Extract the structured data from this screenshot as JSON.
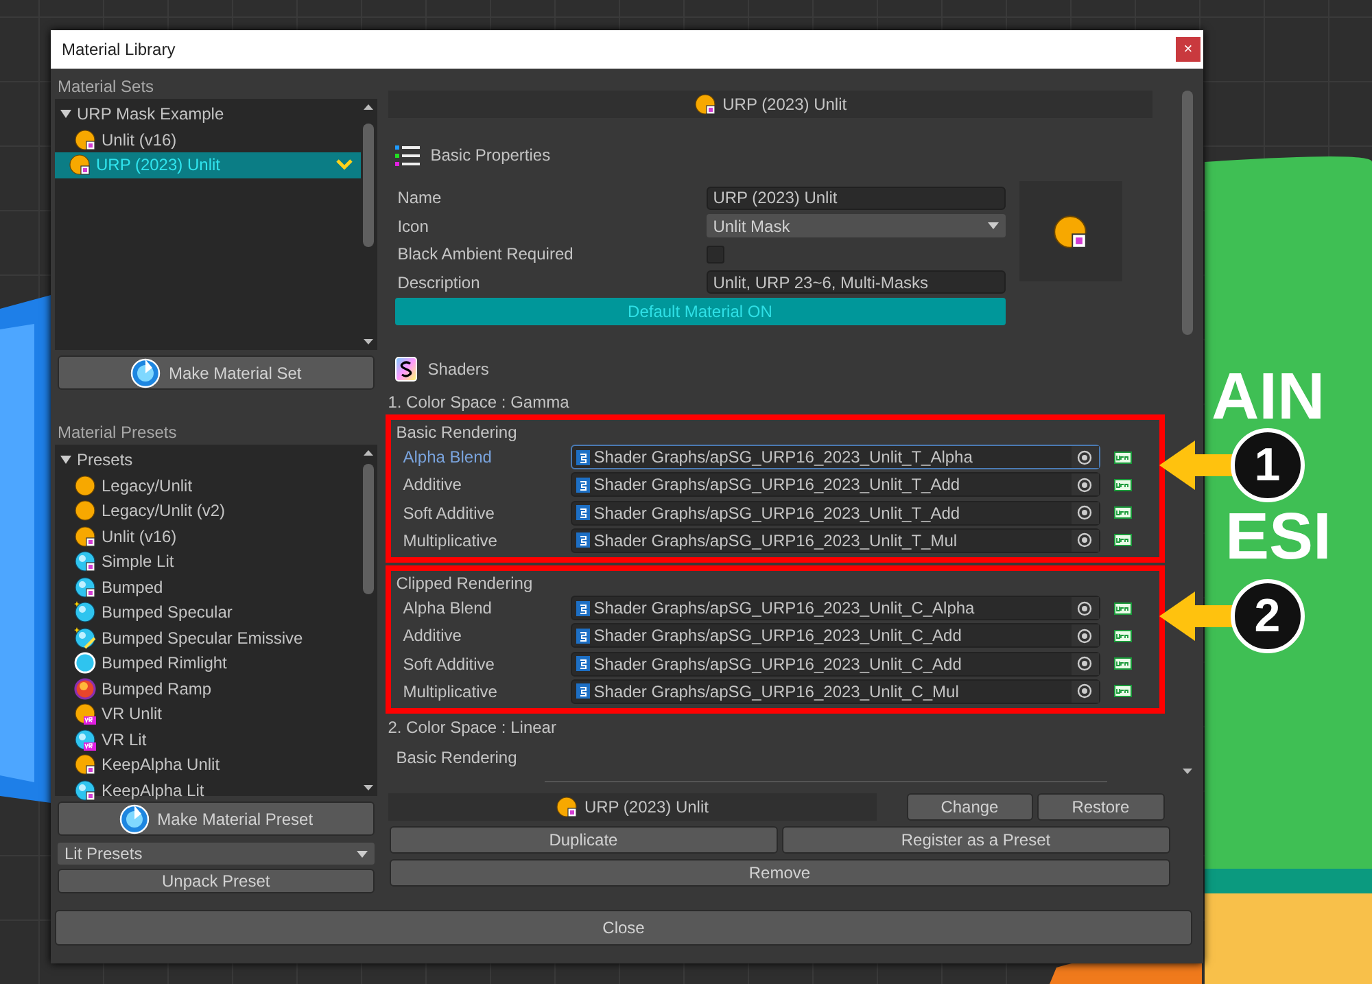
{
  "window": {
    "title": "Material Library",
    "close_label": "×"
  },
  "canvas": {
    "texts": [
      "AIN",
      "ESI"
    ]
  },
  "material_sets": {
    "title": "Material Sets",
    "tree": {
      "label": "URP Mask Example",
      "expanded": true,
      "children": [
        {
          "label": "Unlit (v16)",
          "kind": "unlit-mask",
          "selected": false
        },
        {
          "label": "URP (2023) Unlit",
          "kind": "unlit-mask",
          "selected": true
        }
      ]
    },
    "button": "Make Material Set"
  },
  "material_presets": {
    "title": "Material Presets",
    "tree": {
      "label": "Presets",
      "expanded": true,
      "children": [
        {
          "label": "Legacy/Unlit",
          "kind": "unlit",
          "selected": false
        },
        {
          "label": "Legacy/Unlit (v2)",
          "kind": "unlit",
          "selected": false
        },
        {
          "label": "Unlit (v16)",
          "kind": "unlit-mask",
          "selected": false
        },
        {
          "label": "Simple Lit",
          "kind": "lit-mask",
          "selected": false
        },
        {
          "label": "Bumped",
          "kind": "lit-mask",
          "selected": false
        },
        {
          "label": "Bumped Specular",
          "kind": "specular",
          "selected": false
        },
        {
          "label": "Bumped Specular Emissive",
          "kind": "emissive",
          "selected": false
        },
        {
          "label": "Bumped Rimlight",
          "kind": "rimlight",
          "selected": false
        },
        {
          "label": "Bumped Ramp",
          "kind": "ramp",
          "selected": false
        },
        {
          "label": "VR Unlit",
          "kind": "vr-unlit",
          "selected": false
        },
        {
          "label": "VR Lit",
          "kind": "vr-lit",
          "selected": false
        },
        {
          "label": "KeepAlpha Unlit",
          "kind": "unlit-mask",
          "selected": false
        },
        {
          "label": "KeepAlpha Lit",
          "kind": "lit-mask",
          "selected": false
        }
      ]
    },
    "button": "Make Material Preset",
    "dropdown": "Lit Presets",
    "unpack_button": "Unpack Preset"
  },
  "header": {
    "title": "URP (2023) Unlit",
    "kind": "unlit-mask"
  },
  "basic_properties": {
    "title": "Basic Properties",
    "fields": [
      {
        "label": "Name",
        "kind": "text",
        "value": "URP (2023) Unlit"
      },
      {
        "label": "Icon",
        "kind": "dropdown",
        "value": "Unlit Mask"
      },
      {
        "label": "Black Ambient Required",
        "kind": "checkbox",
        "checked": false
      },
      {
        "label": "Description",
        "kind": "text",
        "value": "Unlit, URP 23~6, Multi-Masks"
      }
    ],
    "default_button": {
      "label": "Default Material ON",
      "on": true
    }
  },
  "shaders": {
    "title": "Shaders",
    "color_spaces": [
      {
        "title": "1. Color Space : Gamma",
        "groups": [
          {
            "title": "Basic Rendering",
            "highlighted": true,
            "callout": "1",
            "rows": [
              {
                "label": "Alpha Blend",
                "value": "Shader Graphs/apSG_URP16_2023_Unlit_T_Alpha",
                "selected": true
              },
              {
                "label": "Additive",
                "value": "Shader Graphs/apSG_URP16_2023_Unlit_T_Add",
                "selected": false
              },
              {
                "label": "Soft Additive",
                "value": "Shader Graphs/apSG_URP16_2023_Unlit_T_Add",
                "selected": false
              },
              {
                "label": "Multiplicative",
                "value": "Shader Graphs/apSG_URP16_2023_Unlit_T_Mul",
                "selected": false
              }
            ]
          },
          {
            "title": "Clipped Rendering",
            "highlighted": true,
            "callout": "2",
            "rows": [
              {
                "label": "Alpha Blend",
                "value": "Shader Graphs/apSG_URP16_2023_Unlit_C_Alpha",
                "selected": false
              },
              {
                "label": "Additive",
                "value": "Shader Graphs/apSG_URP16_2023_Unlit_C_Add",
                "selected": false
              },
              {
                "label": "Soft Additive",
                "value": "Shader Graphs/apSG_URP16_2023_Unlit_C_Add",
                "selected": false
              },
              {
                "label": "Multiplicative",
                "value": "Shader Graphs/apSG_URP16_2023_Unlit_C_Mul",
                "selected": false
              }
            ]
          }
        ]
      },
      {
        "title": "2. Color Space : Linear",
        "groups": [
          {
            "title": "Basic Rendering",
            "highlighted": false
          }
        ]
      }
    ]
  },
  "selection": {
    "title": "URP (2023) Unlit",
    "kind": "unlit-mask",
    "buttons": [
      "Change",
      "Restore",
      "Duplicate",
      "Register as a Preset",
      "Remove"
    ]
  },
  "close_button": "Close"
}
